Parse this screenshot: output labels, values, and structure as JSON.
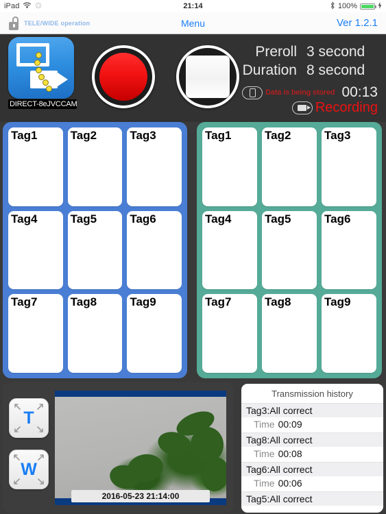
{
  "statusbar": {
    "device": "iPad",
    "wifi_icon": "wifi-icon",
    "activity_icon": "activity-spinner-icon",
    "time": "21:14",
    "bluetooth_icon": "bluetooth-icon",
    "battery_percent": "100%",
    "battery_icon": "battery-charging-icon"
  },
  "navbar": {
    "lock_icon": "unlocked-padlock-icon",
    "lock_label": "TELE/WIDE operation",
    "menu": "Menu",
    "version": "Ver 1.2.1"
  },
  "control": {
    "camera_icon": "camera-connection-icon",
    "camera_name": "DIRECT-8eJVCCAM",
    "record_button": "record-button",
    "stop_button": "stop-button",
    "preroll_label": "Preroll",
    "preroll_value": "3 second",
    "duration_label": "Duration",
    "duration_value": "8 second",
    "stored_icon": "tablet-storage-icon",
    "stored_text": "Data is being stored",
    "stored_time": "00:13",
    "recording_icon": "camcorder-icon",
    "recording_text": "Recording",
    "accent_recording": "#ee1111",
    "accent_stored": "#b02020"
  },
  "panels": {
    "blue": {
      "color": "#4a7ed4",
      "tags": [
        "Tag1",
        "Tag2",
        "Tag3",
        "Tag4",
        "Tag5",
        "Tag6",
        "Tag7",
        "Tag8",
        "Tag9"
      ]
    },
    "teal": {
      "color": "#55ab97",
      "tags": [
        "Tag1",
        "Tag2",
        "Tag3",
        "Tag4",
        "Tag5",
        "Tag6",
        "Tag7",
        "Tag8",
        "Tag9"
      ]
    }
  },
  "bottom": {
    "zoom_tele": "T",
    "zoom_wide": "W",
    "preview_timestamp": "2016-05-23 21:14:00",
    "history": {
      "title": "Transmission history",
      "time_label": "Time",
      "items": [
        {
          "head": "Tag3:All correct",
          "time": "00:09"
        },
        {
          "head": "Tag8:All correct",
          "time": "00:08"
        },
        {
          "head": "Tag6:All correct",
          "time": "00:06"
        },
        {
          "head": "Tag5:All correct",
          "time": ""
        }
      ]
    }
  }
}
